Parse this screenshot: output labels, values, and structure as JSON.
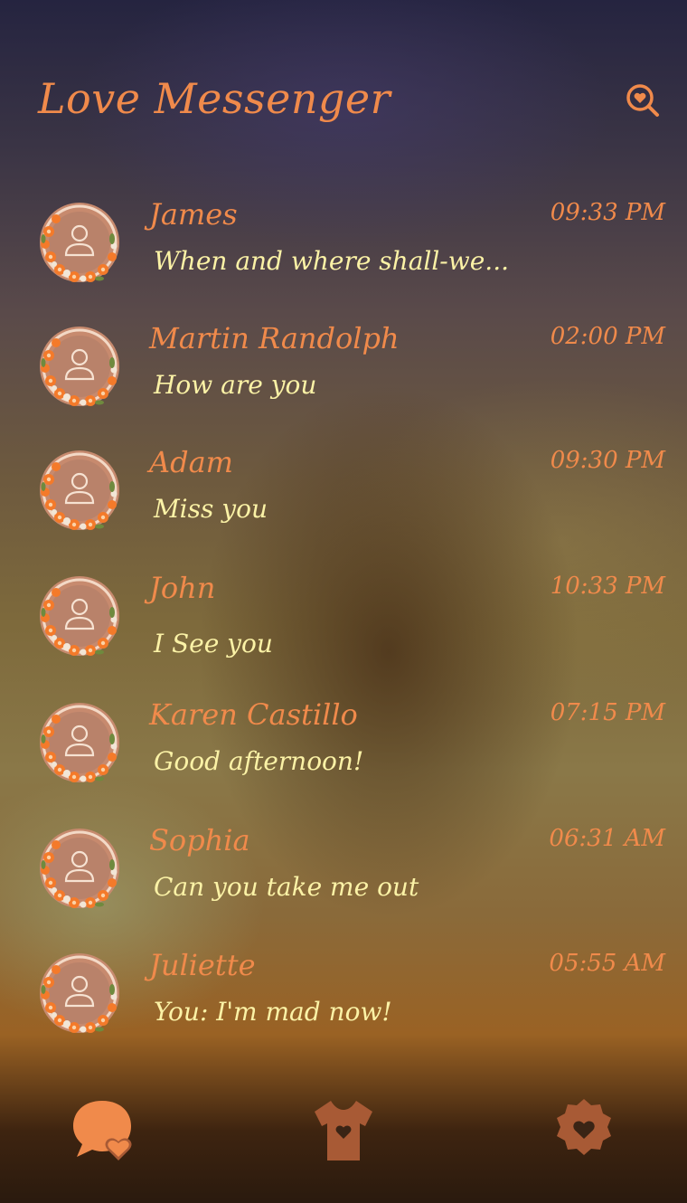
{
  "app": {
    "title": "Love Messenger"
  },
  "header": {
    "search_icon": "search-heart-icon"
  },
  "colors": {
    "accent": "#f08a4b",
    "preview_text": "#fbf2a6",
    "tab_icon": "#a85a35",
    "tab_icon_active": "#f08a4b"
  },
  "conversations": [
    {
      "name": "James",
      "time": "09:33 PM",
      "preview": "When and where shall-we..."
    },
    {
      "name": "Martin Randolph",
      "time": "02:00 PM",
      "preview": "How are you"
    },
    {
      "name": "Adam",
      "time": "09:30 PM",
      "preview": "Miss you"
    },
    {
      "name": "John",
      "time": "10:33 PM",
      "preview": "I See you"
    },
    {
      "name": "Karen Castillo",
      "time": "07:15 PM",
      "preview": "Good afternoon!"
    },
    {
      "name": "Sophia",
      "time": "06:31 AM",
      "preview": "Can you take me out"
    },
    {
      "name": "Juliette",
      "time": "05:55 AM",
      "preview": "You: I'm mad now!"
    }
  ],
  "tabs": [
    {
      "icon": "chat-heart-icon",
      "active": true
    },
    {
      "icon": "shirt-heart-icon",
      "active": false
    },
    {
      "icon": "settings-heart-icon",
      "active": false
    }
  ]
}
